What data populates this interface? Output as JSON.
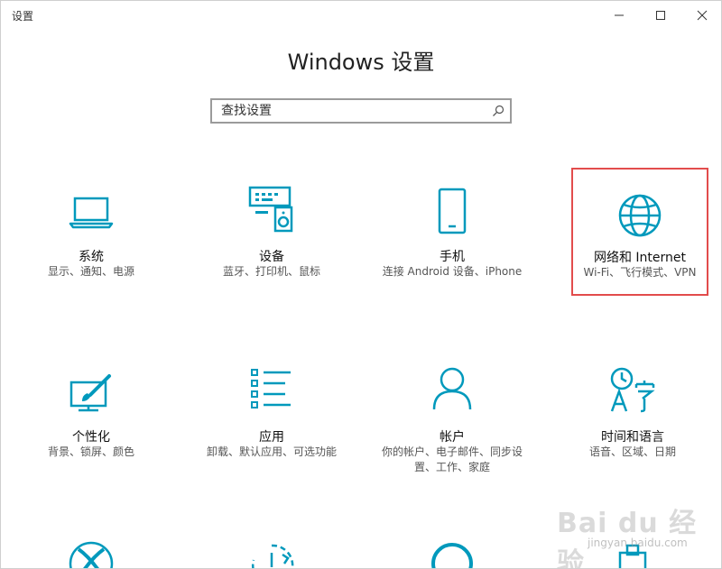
{
  "window": {
    "title": "设置"
  },
  "page": {
    "title": "Windows 设置"
  },
  "search": {
    "placeholder": "查找设置"
  },
  "colors": {
    "accent": "#0099bc",
    "highlight_border": "#e24c4c"
  },
  "tiles": [
    {
      "title": "系统",
      "desc": "显示、通知、电源",
      "icon": "laptop-icon"
    },
    {
      "title": "设备",
      "desc": "蓝牙、打印机、鼠标",
      "icon": "devices-icon"
    },
    {
      "title": "手机",
      "desc": "连接 Android 设备、iPhone",
      "icon": "phone-icon"
    },
    {
      "title": "网络和 Internet",
      "desc": "Wi-Fi、飞行模式、VPN",
      "icon": "globe-icon",
      "highlighted": true
    },
    {
      "title": "个性化",
      "desc": "背景、锁屏、颜色",
      "icon": "paint-icon"
    },
    {
      "title": "应用",
      "desc": "卸载、默认应用、可选功能",
      "icon": "apps-list-icon"
    },
    {
      "title": "帐户",
      "desc": "你的帐户、电子邮件、同步设置、工作、家庭",
      "icon": "person-icon"
    },
    {
      "title": "时间和语言",
      "desc": "语音、区域、日期",
      "icon": "time-language-icon"
    }
  ],
  "watermark": {
    "brand": "Bai du 经验",
    "url": "jingyan.baidu.com"
  }
}
